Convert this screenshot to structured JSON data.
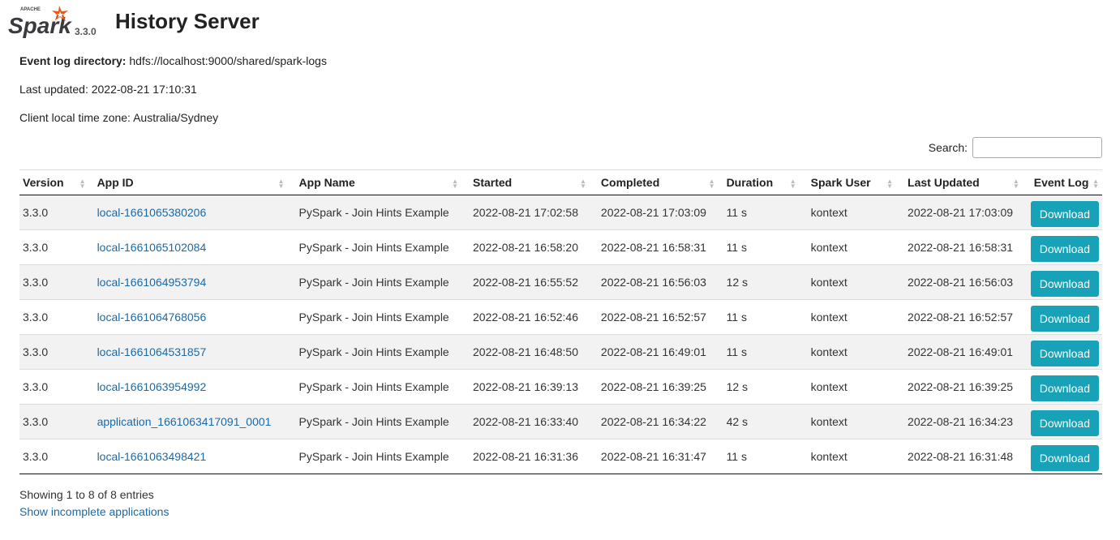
{
  "header": {
    "logo_small_text": "APACHE",
    "logo_text": "Spark",
    "version": "3.3.0",
    "title": "History Server"
  },
  "info": {
    "event_log_label": "Event log directory:",
    "event_log_value": "hdfs://localhost:9000/shared/spark-logs",
    "last_updated": "Last updated: 2022-08-21 17:10:31",
    "timezone": "Client local time zone: Australia/Sydney"
  },
  "search": {
    "label": "Search:",
    "value": "",
    "placeholder": ""
  },
  "table": {
    "columns": [
      "Version",
      "App ID",
      "App Name",
      "Started",
      "Completed",
      "Duration",
      "Spark User",
      "Last Updated",
      "Event Log"
    ],
    "rows": [
      {
        "version": "3.3.0",
        "app_id": "local-1661065380206",
        "app_name": "PySpark - Join Hints Example",
        "started": "2022-08-21 17:02:58",
        "completed": "2022-08-21 17:03:09",
        "duration": "11 s",
        "user": "kontext",
        "last_updated": "2022-08-21 17:03:09",
        "event_log": "Download"
      },
      {
        "version": "3.3.0",
        "app_id": "local-1661065102084",
        "app_name": "PySpark - Join Hints Example",
        "started": "2022-08-21 16:58:20",
        "completed": "2022-08-21 16:58:31",
        "duration": "11 s",
        "user": "kontext",
        "last_updated": "2022-08-21 16:58:31",
        "event_log": "Download"
      },
      {
        "version": "3.3.0",
        "app_id": "local-1661064953794",
        "app_name": "PySpark - Join Hints Example",
        "started": "2022-08-21 16:55:52",
        "completed": "2022-08-21 16:56:03",
        "duration": "12 s",
        "user": "kontext",
        "last_updated": "2022-08-21 16:56:03",
        "event_log": "Download"
      },
      {
        "version": "3.3.0",
        "app_id": "local-1661064768056",
        "app_name": "PySpark - Join Hints Example",
        "started": "2022-08-21 16:52:46",
        "completed": "2022-08-21 16:52:57",
        "duration": "11 s",
        "user": "kontext",
        "last_updated": "2022-08-21 16:52:57",
        "event_log": "Download"
      },
      {
        "version": "3.3.0",
        "app_id": "local-1661064531857",
        "app_name": "PySpark - Join Hints Example",
        "started": "2022-08-21 16:48:50",
        "completed": "2022-08-21 16:49:01",
        "duration": "11 s",
        "user": "kontext",
        "last_updated": "2022-08-21 16:49:01",
        "event_log": "Download"
      },
      {
        "version": "3.3.0",
        "app_id": "local-1661063954992",
        "app_name": "PySpark - Join Hints Example",
        "started": "2022-08-21 16:39:13",
        "completed": "2022-08-21 16:39:25",
        "duration": "12 s",
        "user": "kontext",
        "last_updated": "2022-08-21 16:39:25",
        "event_log": "Download"
      },
      {
        "version": "3.3.0",
        "app_id": "application_1661063417091_0001",
        "app_name": "PySpark - Join Hints Example",
        "started": "2022-08-21 16:33:40",
        "completed": "2022-08-21 16:34:22",
        "duration": "42 s",
        "user": "kontext",
        "last_updated": "2022-08-21 16:34:23",
        "event_log": "Download"
      },
      {
        "version": "3.3.0",
        "app_id": "local-1661063498421",
        "app_name": "PySpark - Join Hints Example",
        "started": "2022-08-21 16:31:36",
        "completed": "2022-08-21 16:31:47",
        "duration": "11 s",
        "user": "kontext",
        "last_updated": "2022-08-21 16:31:48",
        "event_log": "Download"
      }
    ]
  },
  "footer": {
    "count": "Showing 1 to 8 of 8 entries",
    "incomplete_link": "Show incomplete applications"
  },
  "colors": {
    "accent": "#17a2b8",
    "link": "#1a6aa8",
    "logo_orange": "#e25a1c"
  }
}
